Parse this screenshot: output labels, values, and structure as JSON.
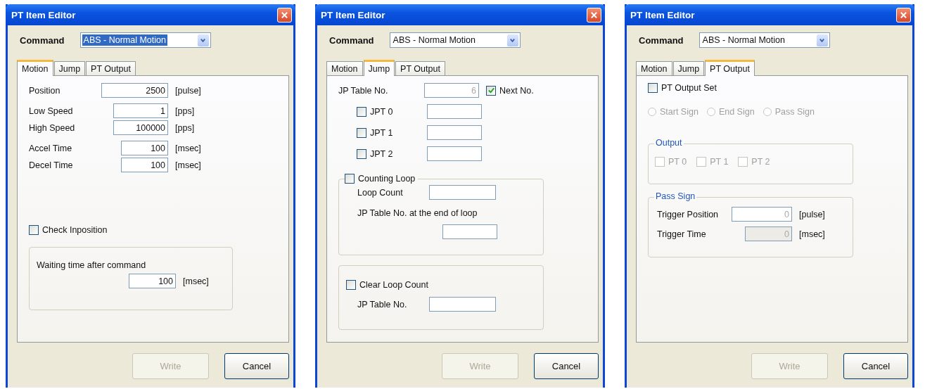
{
  "windows": [
    {
      "title": "PT Item Editor",
      "command": {
        "label": "Command",
        "value": "ABS - Normal Motion",
        "text_selected": true
      },
      "tabs": [
        {
          "label": "Motion",
          "selected": true
        },
        {
          "label": "Jump",
          "selected": false
        },
        {
          "label": "PT Output",
          "selected": false
        }
      ],
      "panel": {
        "kind": "motion",
        "field_groups": [
          {
            "fields": [
              {
                "label": "Position",
                "value": "2500",
                "unit": "[pulse]"
              }
            ]
          },
          {
            "fields": [
              {
                "label": "Low Speed",
                "value": "1",
                "unit": "[pps]"
              },
              {
                "label": "High Speed",
                "value": "100000",
                "unit": "[pps]"
              }
            ]
          },
          {
            "fields": [
              {
                "label": "Accel Time",
                "value": "100",
                "unit": "[msec]"
              },
              {
                "label": "Decel Time",
                "value": "100",
                "unit": "[msec]"
              }
            ]
          }
        ],
        "check_inposition": {
          "label": "Check Inposition",
          "checked": false
        },
        "waiting": {
          "label": "Waiting time after command",
          "value": "100",
          "unit": "[msec]"
        }
      },
      "buttons": [
        {
          "label": "Write",
          "disabled": true
        },
        {
          "label": "Cancel",
          "disabled": false
        }
      ]
    },
    {
      "title": "PT Item Editor",
      "command": {
        "label": "Command",
        "value": "ABS - Normal Motion",
        "text_selected": false
      },
      "tabs": [
        {
          "label": "Motion",
          "selected": false
        },
        {
          "label": "Jump",
          "selected": true
        },
        {
          "label": "PT Output",
          "selected": false
        }
      ],
      "panel": {
        "kind": "jump",
        "jp_table": {
          "label": "JP Table No.",
          "value": "6",
          "disabled": true
        },
        "next_no": {
          "label": "Next No.",
          "checked": true
        },
        "jpt": [
          {
            "label": "JPT 0",
            "checked": false
          },
          {
            "label": "JPT 1",
            "checked": false
          },
          {
            "label": "JPT 2",
            "checked": false
          }
        ],
        "counting_loop": {
          "label": "Counting Loop",
          "checked": false,
          "loop_count_label": "Loop Count",
          "end_label": "JP Table No. at the end of loop"
        },
        "clear_loop": {
          "label": "Clear Loop Count",
          "checked": false,
          "table_label": "JP Table No."
        }
      },
      "buttons": [
        {
          "label": "Write",
          "disabled": true
        },
        {
          "label": "Cancel",
          "disabled": false
        }
      ]
    },
    {
      "title": "PT Item Editor",
      "command": {
        "label": "Command",
        "value": "ABS - Normal Motion",
        "text_selected": false
      },
      "tabs": [
        {
          "label": "Motion",
          "selected": false
        },
        {
          "label": "Jump",
          "selected": false
        },
        {
          "label": "PT Output",
          "selected": true
        }
      ],
      "panel": {
        "kind": "pt_output",
        "output_set": {
          "label": "PT Output Set",
          "checked": false
        },
        "signs": [
          {
            "label": "Start Sign",
            "selected": false,
            "disabled": true
          },
          {
            "label": "End Sign",
            "selected": false,
            "disabled": true
          },
          {
            "label": "Pass Sign",
            "selected": false,
            "disabled": true
          }
        ],
        "output": {
          "title": "Output",
          "items": [
            {
              "label": "PT 0",
              "checked": false,
              "disabled": true
            },
            {
              "label": "PT 1",
              "checked": false,
              "disabled": true
            },
            {
              "label": "PT 2",
              "checked": false,
              "disabled": true
            }
          ]
        },
        "pass_sign": {
          "title": "Pass Sign",
          "rows": [
            {
              "label": "Trigger Position",
              "value": "0",
              "unit": "[pulse]",
              "disabled": true
            },
            {
              "label": "Trigger Time",
              "value": "0",
              "unit": "[msec]",
              "disabled": true
            }
          ]
        }
      },
      "buttons": [
        {
          "label": "Write",
          "disabled": true
        },
        {
          "label": "Cancel",
          "disabled": false
        }
      ]
    }
  ]
}
